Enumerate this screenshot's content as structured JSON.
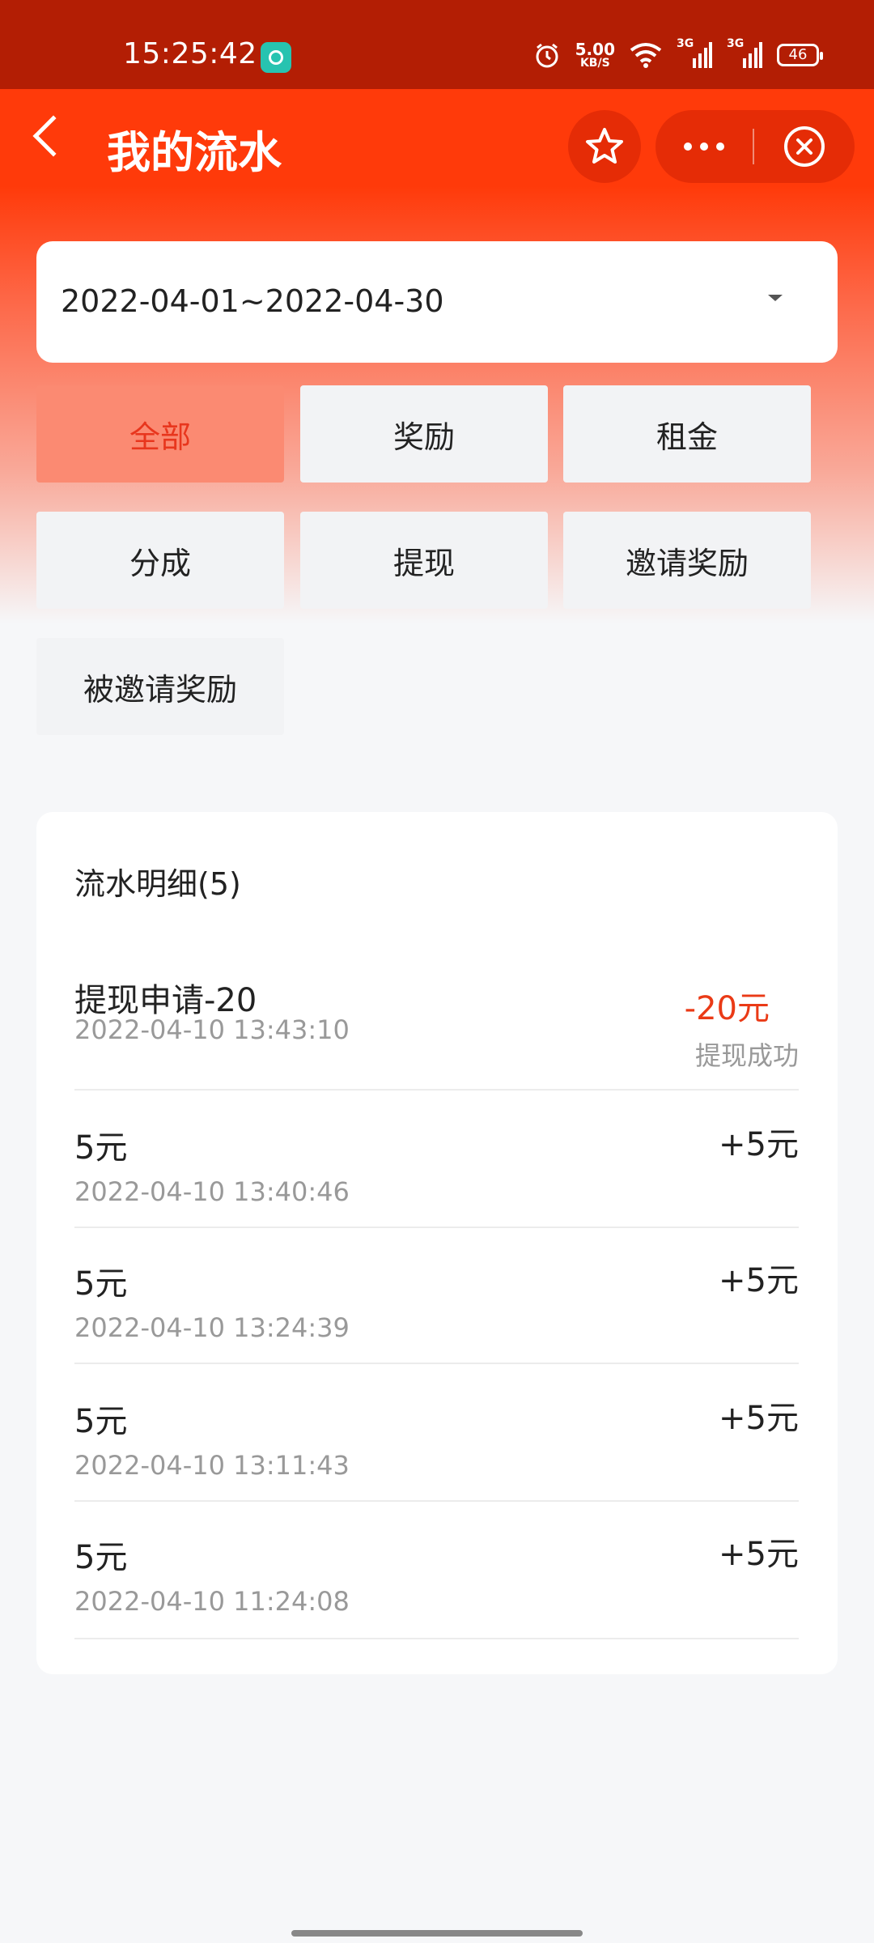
{
  "status_bar": {
    "time": "15:25:42",
    "net_speed": "5.00",
    "net_unit": "KB/S",
    "signal1": "3G",
    "signal2": "3G",
    "battery": "46"
  },
  "nav": {
    "title": "我的流水"
  },
  "date_range": {
    "value": "2022-04-01~2022-04-30"
  },
  "filters": [
    {
      "label": "全部",
      "active": true
    },
    {
      "label": "奖励"
    },
    {
      "label": "租金"
    },
    {
      "label": "分成"
    },
    {
      "label": "提现"
    },
    {
      "label": "邀请奖励"
    },
    {
      "label": "被邀请奖励"
    }
  ],
  "list": {
    "title": "流水明细(5)",
    "items": [
      {
        "title": "提现申请-20",
        "time": "2022-04-10 13:43:10",
        "amount": "-20元",
        "status": "提现成功"
      },
      {
        "title": "5元",
        "time": "2022-04-10 13:40:46",
        "amount": "+5元"
      },
      {
        "title": "5元",
        "time": "2022-04-10 13:24:39",
        "amount": "+5元"
      },
      {
        "title": "5元",
        "time": "2022-04-10 13:11:43",
        "amount": "+5元"
      },
      {
        "title": "5元",
        "time": "2022-04-10 11:24:08",
        "amount": "+5元"
      }
    ]
  },
  "colors": {
    "brand": "#ff3a0a",
    "negative": "#ea3a16",
    "active_filter_bg": "#fb8a72"
  }
}
